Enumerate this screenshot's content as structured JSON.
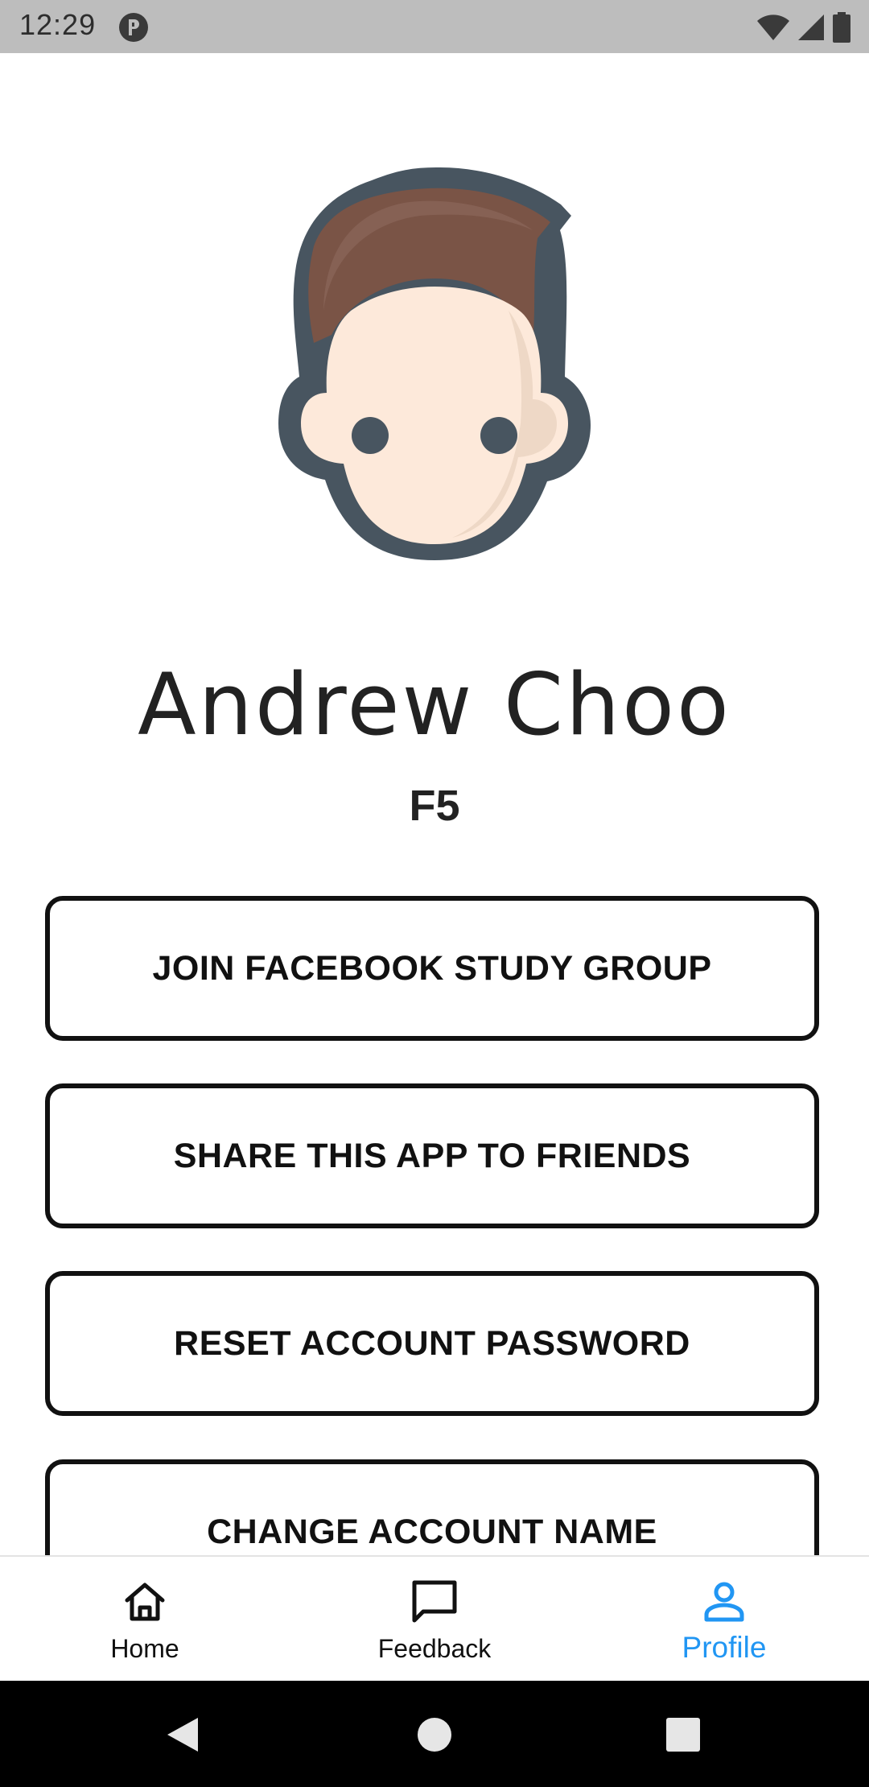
{
  "status_bar": {
    "time": "12:29",
    "app_icon": "notification-app-icon",
    "icons": [
      "wifi-icon",
      "cell-signal-icon",
      "battery-icon"
    ]
  },
  "profile": {
    "avatar_icon": "male-avatar-icon",
    "name": "Andrew Choo",
    "class": "F5"
  },
  "actions": {
    "join_facebook": "JOIN FACEBOOK STUDY GROUP",
    "share_app": "SHARE THIS APP TO FRIENDS",
    "reset_password": "RESET ACCOUNT PASSWORD",
    "change_name": "CHANGE ACCOUNT NAME"
  },
  "bottom_nav": {
    "items": [
      {
        "label": "Home",
        "icon": "home-icon",
        "active": false
      },
      {
        "label": "Feedback",
        "icon": "chat-bubble-icon",
        "active": false
      },
      {
        "label": "Profile",
        "icon": "person-icon",
        "active": true
      }
    ]
  },
  "colors": {
    "active_tab": "#2196f3",
    "inactive_tab": "#111111",
    "status_bar": "#bdbdbd",
    "button_border": "#111111",
    "system_nav": "#000000"
  },
  "system_nav": {
    "icons": [
      "back-icon",
      "home-circle-icon",
      "recents-icon"
    ]
  }
}
